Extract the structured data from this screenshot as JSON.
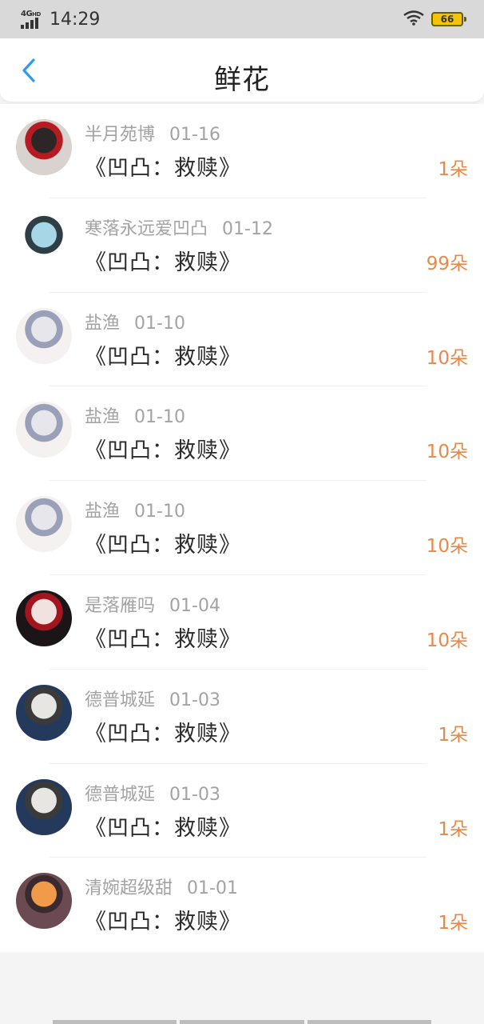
{
  "status_bar": {
    "network": "4G",
    "network_suffix": "HD",
    "time": "14:29",
    "battery": "66"
  },
  "header": {
    "title": "鲜花"
  },
  "items": [
    {
      "user": "半月苑博",
      "date": "01-16",
      "book": "《凹凸：救赎》",
      "count": "1朵",
      "avatar_colors": [
        "#d9d3cf",
        "#2d2626",
        "#b51c22"
      ]
    },
    {
      "user": "寒落永远爱凹凸",
      "date": "01-12",
      "book": "《凹凸：救赎》",
      "count": "99朵",
      "avatar_colors": [
        "#ffffff",
        "#a7d6e6",
        "#2f3e45"
      ]
    },
    {
      "user": "盐渔",
      "date": "01-10",
      "book": "《凹凸：救赎》",
      "count": "10朵",
      "avatar_colors": [
        "#f4f1f0",
        "#e7e6ea",
        "#9aa0b8"
      ]
    },
    {
      "user": "盐渔",
      "date": "01-10",
      "book": "《凹凸：救赎》",
      "count": "10朵",
      "avatar_colors": [
        "#f4f1f0",
        "#e7e6ea",
        "#9aa0b8"
      ]
    },
    {
      "user": "盐渔",
      "date": "01-10",
      "book": "《凹凸：救赎》",
      "count": "10朵",
      "avatar_colors": [
        "#f4f1f0",
        "#e7e6ea",
        "#9aa0b8"
      ]
    },
    {
      "user": "是落雁吗",
      "date": "01-04",
      "book": "《凹凸：救赎》",
      "count": "10朵",
      "avatar_colors": [
        "#1b1518",
        "#f1e2e0",
        "#a3151e"
      ]
    },
    {
      "user": "德普城延",
      "date": "01-03",
      "book": "《凹凸：救赎》",
      "count": "1朵",
      "avatar_colors": [
        "#243a5c",
        "#e8e6e3",
        "#3a3a3a"
      ]
    },
    {
      "user": "德普城延",
      "date": "01-03",
      "book": "《凹凸：救赎》",
      "count": "1朵",
      "avatar_colors": [
        "#243a5c",
        "#e8e6e3",
        "#3a3a3a"
      ]
    },
    {
      "user": "清婉超级甜",
      "date": "01-01",
      "book": "《凹凸：救赎》",
      "count": "1朵",
      "avatar_colors": [
        "#6b4a52",
        "#f09a4a",
        "#3a2a2f"
      ]
    }
  ],
  "colors": {
    "accent_back": "#2d9cf0",
    "count": "#e8894a"
  }
}
